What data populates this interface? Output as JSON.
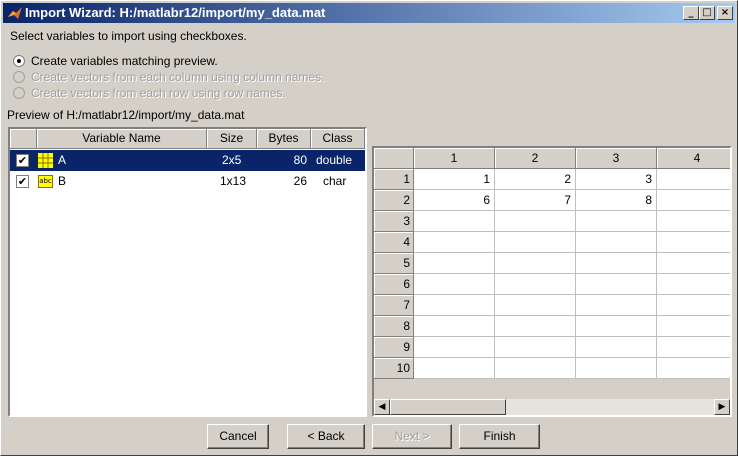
{
  "window": {
    "title": "Import Wizard: H:/matlabr12/import/my_data.mat"
  },
  "titlebar_buttons": {
    "minimize": "_",
    "maximize": "□",
    "close": "×"
  },
  "instruction": "Select variables to import using checkboxes.",
  "options": [
    {
      "label": "Create variables matching preview.",
      "selected": true,
      "enabled": true
    },
    {
      "label": "Create vectors from each column using column names.",
      "selected": false,
      "enabled": false
    },
    {
      "label": "Create vectors from each row using row names.",
      "selected": false,
      "enabled": false
    }
  ],
  "preview_label": "Preview of H:/matlabr12/import/my_data.mat",
  "var_table": {
    "headers": [
      "",
      "Variable Name",
      "Size",
      "Bytes",
      "Class"
    ],
    "rows": [
      {
        "checked": true,
        "check": "✔",
        "icon": "matrix-icon",
        "name": "A",
        "size": "2x5",
        "bytes": "80",
        "class": "double",
        "selected": true
      },
      {
        "checked": true,
        "check": "✔",
        "icon": "abc",
        "name": "B",
        "size": "1x13",
        "bytes": "26",
        "class": "char",
        "selected": false
      }
    ]
  },
  "grid": {
    "col_headers": [
      "1",
      "2",
      "3",
      "4"
    ],
    "row_headers": [
      "1",
      "2",
      "3",
      "4",
      "5",
      "6",
      "7",
      "8",
      "9",
      "10"
    ],
    "cells": [
      [
        "1",
        "2",
        "3",
        ""
      ],
      [
        "6",
        "7",
        "8",
        ""
      ],
      [
        "",
        "",
        "",
        ""
      ],
      [
        "",
        "",
        "",
        ""
      ],
      [
        "",
        "",
        "",
        ""
      ],
      [
        "",
        "",
        "",
        ""
      ],
      [
        "",
        "",
        "",
        ""
      ],
      [
        "",
        "",
        "",
        ""
      ],
      [
        "",
        "",
        "",
        ""
      ],
      [
        "",
        "",
        "",
        ""
      ]
    ]
  },
  "buttons": {
    "cancel": "Cancel",
    "back": "< Back",
    "next": "Next >",
    "finish": "Finish"
  },
  "scroll": {
    "left": "◀",
    "right": "▶"
  }
}
